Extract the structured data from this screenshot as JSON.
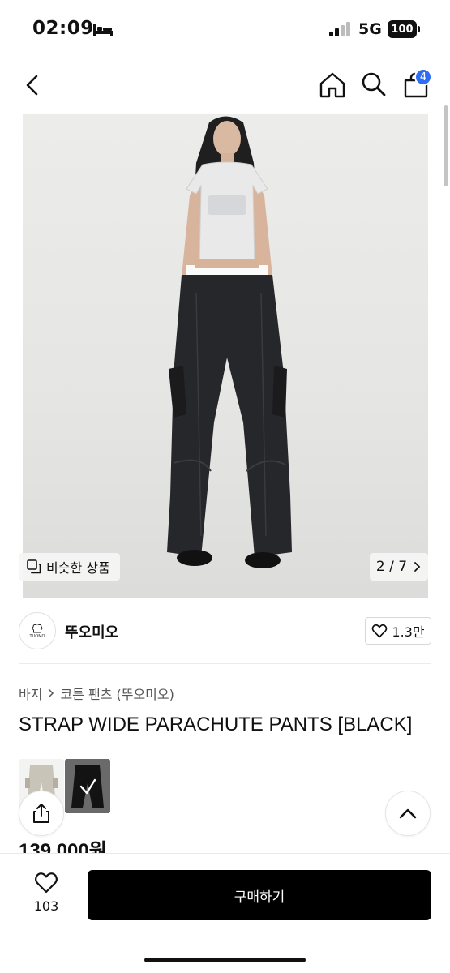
{
  "status_bar": {
    "time": "02:09",
    "network": "5G",
    "battery": "100"
  },
  "nav": {
    "cart_count": "4"
  },
  "gallery": {
    "similar_label": "비슷한 상품",
    "page_indicator": "2 / 7"
  },
  "brand": {
    "name": "뚜오미오",
    "logo_text": "TUOMO",
    "likes": "1.3만"
  },
  "breadcrumb": {
    "category": "바지",
    "subcategory": "코튼 팬츠 (뚜오미오)"
  },
  "product": {
    "title": "STRAP WIDE PARACHUTE PANTS [BLACK]",
    "price": "139,000원",
    "swatches": [
      "beige",
      "black"
    ],
    "selected_swatch": "black"
  },
  "bottom_bar": {
    "wish_count": "103",
    "buy_label": "구매하기"
  },
  "colors": {
    "badge": "#2f6cf6",
    "buy_button": "#000000"
  }
}
